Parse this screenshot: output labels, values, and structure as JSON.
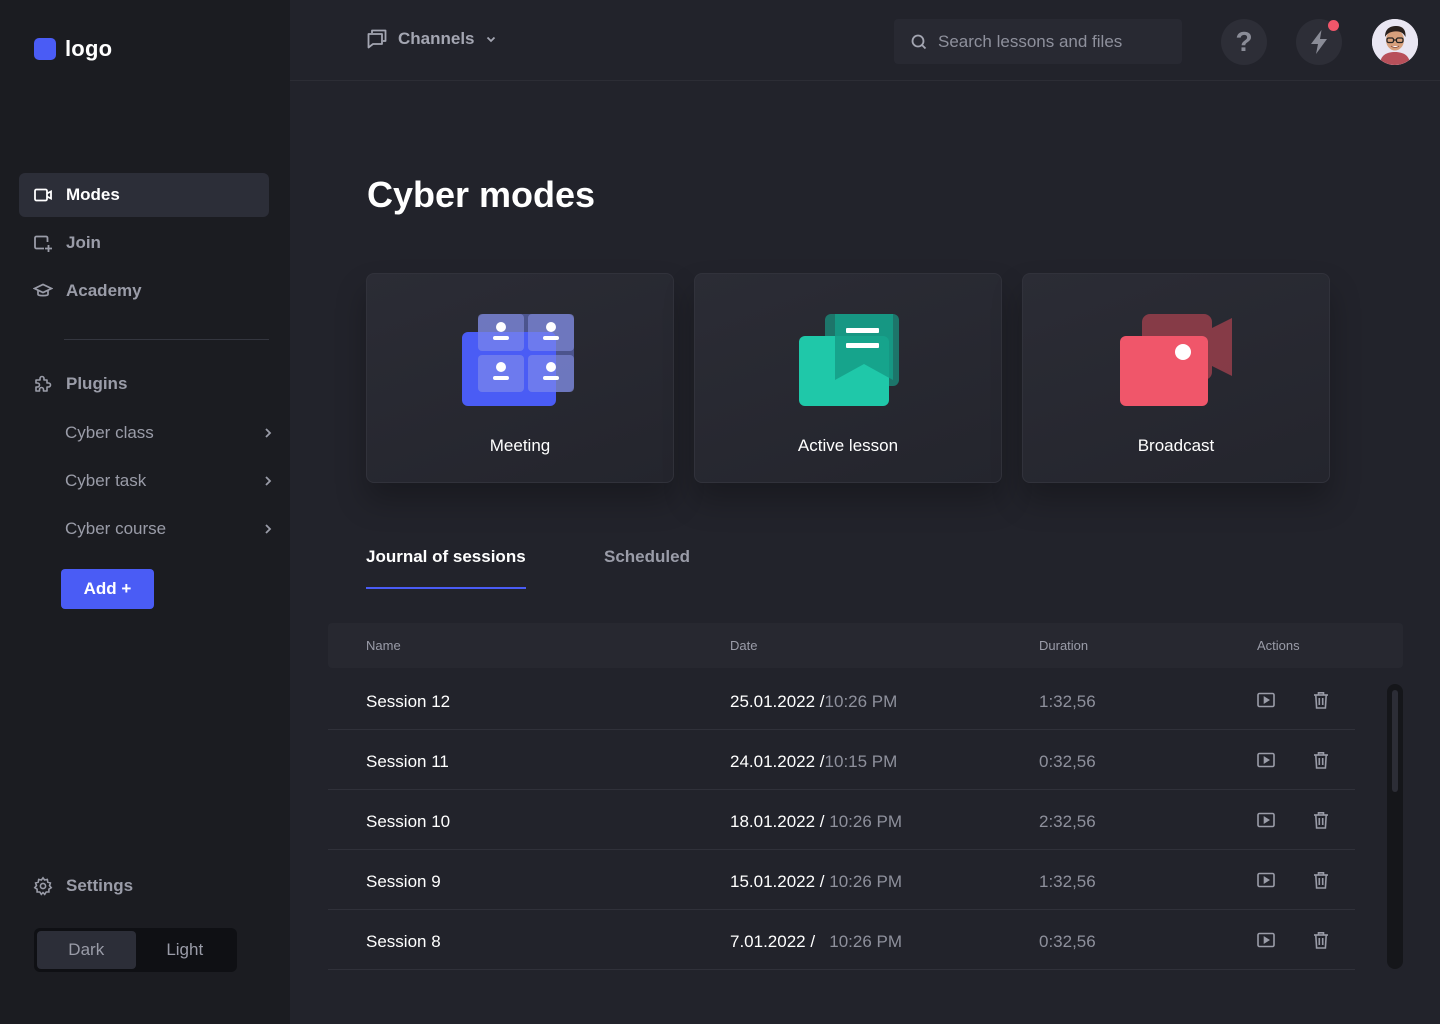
{
  "brand": {
    "logo_text": "logo",
    "accent": "#4a5cf5"
  },
  "sidebar": {
    "nav": [
      {
        "label": "Modes",
        "icon": "video-camera-icon",
        "active": true
      },
      {
        "label": "Join",
        "icon": "join-plus-icon",
        "active": false
      },
      {
        "label": "Academy",
        "icon": "graduation-cap-icon",
        "active": false
      }
    ],
    "plugins": {
      "label": "Plugins",
      "items": [
        {
          "label": "Cyber class"
        },
        {
          "label": "Cyber task"
        },
        {
          "label": "Cyber course"
        }
      ]
    },
    "add_label": "Add +",
    "settings_label": "Settings",
    "theme": {
      "dark": "Dark",
      "light": "Light",
      "selected": "Dark"
    }
  },
  "topbar": {
    "channels_label": "Channels",
    "search_placeholder": "Search lessons and files",
    "help_glyph": "?"
  },
  "main": {
    "title": "Cyber modes",
    "modes": [
      {
        "label": "Meeting",
        "color": "#4a5cf5"
      },
      {
        "label": "Active lesson",
        "color": "#1fc8a9"
      },
      {
        "label": "Broadcast",
        "color": "#f0566a"
      }
    ],
    "tabs": [
      {
        "label": "Journal of sessions",
        "active": true
      },
      {
        "label": "Scheduled",
        "active": false
      }
    ],
    "table": {
      "headers": {
        "name": "Name",
        "date": "Date",
        "duration": "Duration",
        "actions": "Actions"
      },
      "rows": [
        {
          "name": "Session 12",
          "date": "25.01.2022 /",
          "time": "10:26 PM",
          "duration": "1:32,56"
        },
        {
          "name": "Session 11",
          "date": "24.01.2022 /",
          "time": "10:15 PM",
          "duration": "0:32,56"
        },
        {
          "name": "Session 10",
          "date": "18.01.2022 /",
          "time": " 10:26 PM",
          "duration": "2:32,56"
        },
        {
          "name": "Session 9",
          "date": "15.01.2022 /",
          "time": " 10:26 PM",
          "duration": "1:32,56"
        },
        {
          "name": "Session 8",
          "date": "7.01.2022 /",
          "time": "   10:26 PM",
          "duration": "0:32,56"
        }
      ]
    }
  }
}
